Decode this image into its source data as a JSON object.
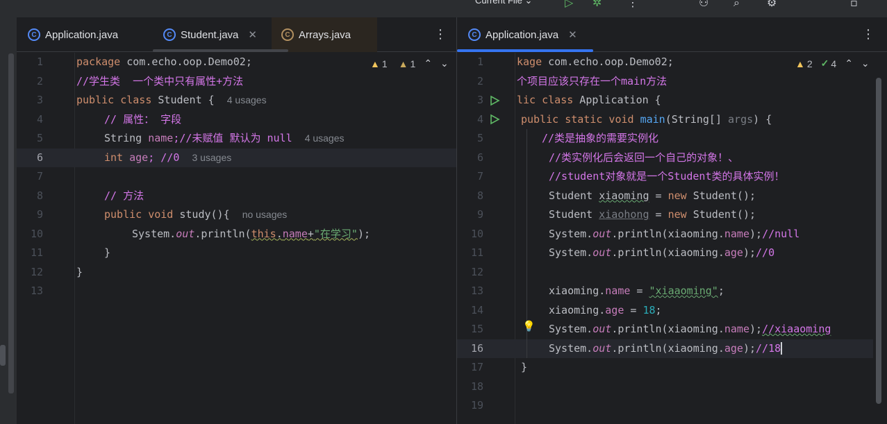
{
  "toolbar": {
    "run_config": "Current File ⌄"
  },
  "left_pane": {
    "tabs": [
      {
        "label": "Application.java",
        "icon": "C"
      },
      {
        "label": "Student.java",
        "icon": "C",
        "close": "✕"
      },
      {
        "label": "Arrays.java",
        "icon": "C"
      }
    ],
    "inspection": {
      "warnings": "1",
      "weak_warnings": "1"
    },
    "line_numbers": [
      "1",
      "2",
      "3",
      "4",
      "5",
      "6",
      "7",
      "8",
      "9",
      "10",
      "11",
      "12",
      "13"
    ],
    "code": {
      "l1_kw": "package",
      "l1_rest": " com.echo.oop.Demo02;",
      "l2": "//学生类  一个类中只有属性+方法",
      "l3_kw": "public class",
      "l3_rest": " Student {",
      "l3_hint": "4 usages",
      "l4": "// 属性： 字段",
      "l5_type": "String ",
      "l5_field": "name",
      "l5_comment": ";//未赋值 默认为 null",
      "l5_hint": "4 usages",
      "l6_kw": "int",
      "l6_field": " age",
      "l6_comment": "; //0",
      "l6_hint": "3 usages",
      "l8": "// 方法",
      "l9_kw": "public void",
      "l9_fn": " study",
      "l9_rest": "(){",
      "l9_hint": "no usages",
      "l10_a": "System.",
      "l10_out": "out",
      "l10_b": ".println(",
      "l10_this": "this",
      "l10_c": ".",
      "l10_name": "name",
      "l10_d": "+",
      "l10_str": "\"在学习\"",
      "l10_e": ");",
      "l11": "}",
      "l12": "}"
    }
  },
  "right_pane": {
    "tabs": [
      {
        "label": "Application.java",
        "icon": "C",
        "close": "✕"
      }
    ],
    "inspection": {
      "warnings": "2",
      "checks": "4"
    },
    "line_numbers": [
      "1",
      "2",
      "3",
      "4",
      "5",
      "6",
      "7",
      "8",
      "9",
      "10",
      "11",
      "12",
      "13",
      "14",
      "15",
      "16",
      "17",
      "18",
      "19"
    ],
    "code": {
      "l1_kw": "kage",
      "l1_rest": " com.echo.oop.Demo02;",
      "l2": "个项目应该只存在一个main方法",
      "l3_kw": "lic class",
      "l3_rest": " Application {",
      "l4_kw": "public static void",
      "l4_fn": " main",
      "l4_rest": "(String[] ",
      "l4_args": "args",
      "l4_end": ") {",
      "l5": "//类是抽象的需要实例化",
      "l6": "//类实例化后会返回一个自己的对象！、",
      "l7": "//student对象就是一个Student类的具体实例！",
      "l8_a": "Student ",
      "l8_var": "xiaoming",
      "l8_b": " = ",
      "l8_kw": "new",
      "l8_c": " Student();",
      "l9_a": "Student ",
      "l9_var": "xiaohong",
      "l9_b": " = ",
      "l9_kw": "new",
      "l9_c": " Student();",
      "l10_a": "System.",
      "l10_out": "out",
      "l10_b": ".println(xiaoming.",
      "l10_f": "name",
      "l10_c": ");",
      "l10_cm": "//null",
      "l11_a": "System.",
      "l11_out": "out",
      "l11_b": ".println(xiaoming.",
      "l11_f": "age",
      "l11_c": ");",
      "l11_cm": "//0",
      "l13_a": "xiaoming.",
      "l13_f": "name",
      "l13_b": " = ",
      "l13_str": "\"xiaaoming\"",
      "l13_c": ";",
      "l14_a": "xiaoming.",
      "l14_f": "age",
      "l14_b": " = ",
      "l14_num": "18",
      "l14_c": ";",
      "l15_a": "System.",
      "l15_out": "out",
      "l15_b": ".println(xiaoming.",
      "l15_f": "name",
      "l15_c": ");",
      "l15_cm": "//xiaaoming",
      "l16_a": "System.",
      "l16_out": "out",
      "l16_b": ".println(xiaoming.",
      "l16_f": "age",
      "l16_c": ");",
      "l16_cm": "//18",
      "l17": "}"
    }
  },
  "colors": {
    "accent": "#548af7",
    "keyword": "#cf8e6d",
    "comment": "#d376e7",
    "string": "#6aab73"
  }
}
